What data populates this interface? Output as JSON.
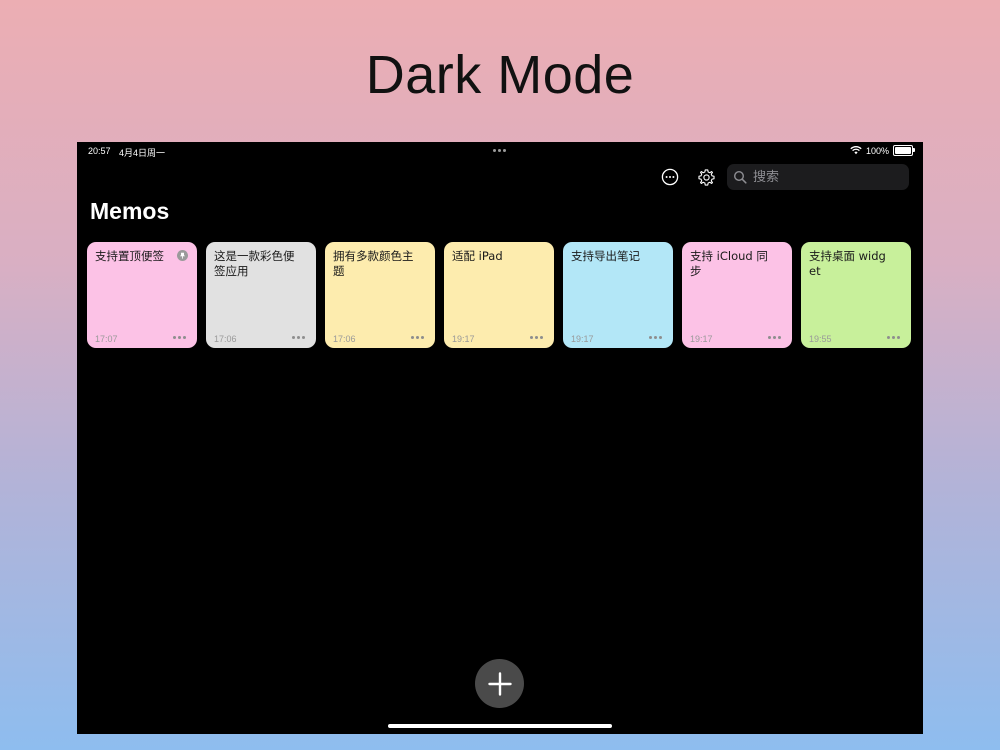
{
  "promo": {
    "title": "Dark Mode"
  },
  "status": {
    "time": "20:57",
    "date": "4月4日周一",
    "battery": "100%"
  },
  "search": {
    "placeholder": "搜索"
  },
  "page": {
    "title": "Memos"
  },
  "memos": [
    {
      "text": "支持置顶便签",
      "time": "17:07",
      "color": "#fcc2e6",
      "pinned": true
    },
    {
      "text": "这是一款彩色便签应用",
      "time": "17:06",
      "color": "#e1e1e1"
    },
    {
      "text": "拥有多款颜色主题",
      "time": "17:06",
      "color": "#fdecae"
    },
    {
      "text": "适配 iPad",
      "time": "19:17",
      "color": "#fdecae"
    },
    {
      "text": "支持导出笔记",
      "time": "19:17",
      "color": "#b3e7f7"
    },
    {
      "text": "支持 iCloud 同步",
      "time": "19:17",
      "color": "#fcc2e6"
    },
    {
      "text": "支持桌面 widget",
      "time": "19:55",
      "color": "#c8f09b"
    }
  ],
  "icons": {
    "more": "ellipsis-circle-icon",
    "settings": "gear-icon",
    "search": "search-icon",
    "add": "plus-icon",
    "pin": "pin-icon",
    "wifi": "wifi-icon",
    "battery": "battery-icon"
  }
}
